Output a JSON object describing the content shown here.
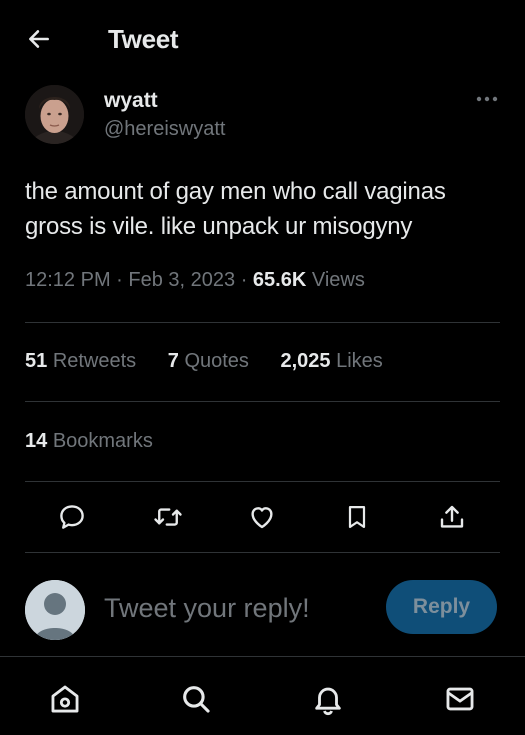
{
  "header": {
    "title": "Tweet",
    "back_icon": "arrow-left-icon"
  },
  "author": {
    "name": "wyatt",
    "handle": "@hereiswyatt"
  },
  "more_icon": "more-dots-icon",
  "tweet": {
    "text": "the amount of gay men who call vaginas gross is vile. like unpack ur misogyny",
    "time": "12:12 PM",
    "date": "Feb 3, 2023",
    "views_count": "65.6K",
    "views_label": "Views"
  },
  "stats": {
    "retweets_count": "51",
    "retweets_label": "Retweets",
    "quotes_count": "7",
    "quotes_label": "Quotes",
    "likes_count": "2,025",
    "likes_label": "Likes",
    "bookmarks_count": "14",
    "bookmarks_label": "Bookmarks"
  },
  "actions": [
    "reply-icon",
    "retweet-icon",
    "like-icon",
    "bookmark-icon",
    "share-icon"
  ],
  "reply": {
    "placeholder": "Tweet your reply!",
    "button_label": "Reply"
  },
  "nav": [
    "home-icon",
    "search-icon",
    "notifications-icon",
    "messages-icon"
  ],
  "colors": {
    "background": "#000000",
    "text": "#e7e9ea",
    "muted": "#71767b",
    "divider": "#2f3336",
    "reply_button": "#0f4e78"
  }
}
